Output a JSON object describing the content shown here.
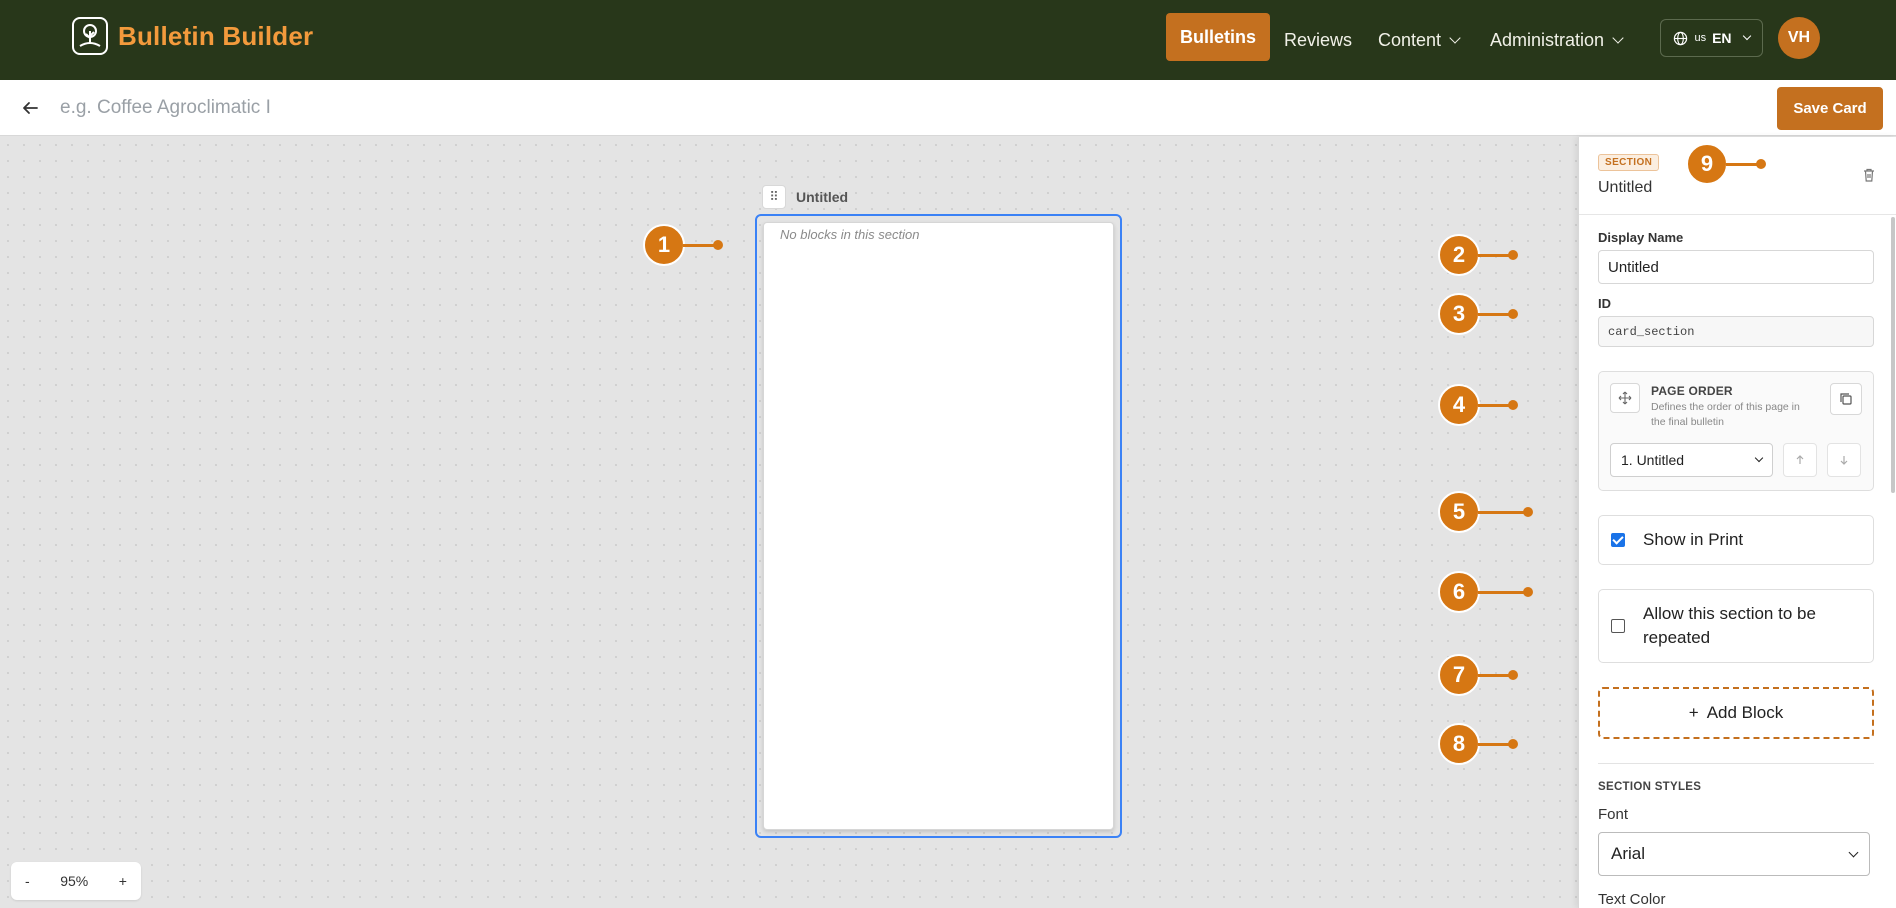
{
  "app": {
    "name": "Bulletin Builder"
  },
  "nav": {
    "items": [
      {
        "label": "Bulletins",
        "active": true
      },
      {
        "label": "Reviews"
      },
      {
        "label": "Content"
      },
      {
        "label": "Administration"
      }
    ],
    "language": {
      "flag": "us",
      "code": "EN"
    },
    "user_initials": "VH"
  },
  "editor": {
    "title_placeholder": "e.g. Coffee Agroclimatic I",
    "save_label": "Save Card"
  },
  "canvas": {
    "section_title": "Untitled",
    "empty_text": "No blocks in this section",
    "zoom": {
      "minus": "-",
      "level": "95%",
      "plus": "+"
    }
  },
  "markers": [
    "1",
    "2",
    "3",
    "4",
    "5",
    "6",
    "7",
    "8",
    "9"
  ],
  "panel": {
    "badge": "SECTION",
    "name": "Untitled",
    "display_name_label": "Display Name",
    "display_name_value": "Untitled",
    "id_label": "ID",
    "id_value": "card_section",
    "page_order": {
      "title": "PAGE ORDER",
      "description": "Defines the order of this page in the final bulletin",
      "selected": "1. Untitled"
    },
    "show_in_print": {
      "label": "Show in Print",
      "checked": true
    },
    "repeatable": {
      "label": "Allow this section to be repeated",
      "checked": false
    },
    "add_block_label": "Add Block",
    "styles_title": "SECTION STYLES",
    "font_label": "Font",
    "font_value": "Arial",
    "text_color_label": "Text Color"
  },
  "colors": {
    "header_bg": "#28371a",
    "accent": "#c4701f",
    "brand_text": "#f39a3c",
    "marker": "#d67713",
    "selection": "#3b82f6"
  }
}
